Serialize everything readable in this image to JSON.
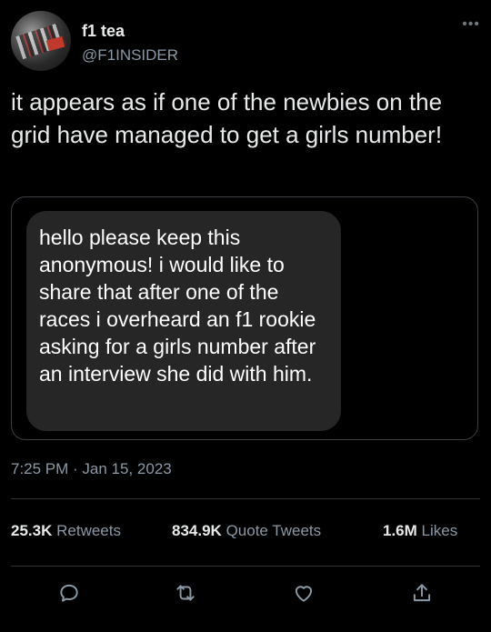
{
  "author": {
    "display_name": "f1 tea",
    "handle": "@F1INSIDER",
    "more_icon": "more-options-icon"
  },
  "tweet": {
    "text": "it appears as if one of the newbies on the grid have managed to get a girls number!",
    "quoted_message": "hello please keep this anonymous! i would like to share that after one of the races i overheard an f1 rookie asking for a girls number after an interview she did with him.",
    "timestamp": "7:25 PM · Jan 15, 2023"
  },
  "stats": {
    "retweets_count": "25.3K",
    "retweets_label": "Retweets",
    "quotes_count": "834.9K",
    "quotes_label": "Quote Tweets",
    "likes_count": "1.6M",
    "likes_label": "Likes"
  },
  "actions": [
    "reply-icon",
    "retweet-icon",
    "like-icon",
    "share-icon"
  ],
  "colors": {
    "background": "#000000",
    "text": "#e7e9ea",
    "secondary_text": "#8b98a5",
    "bubble": "#262626",
    "border": "#2f3336"
  }
}
